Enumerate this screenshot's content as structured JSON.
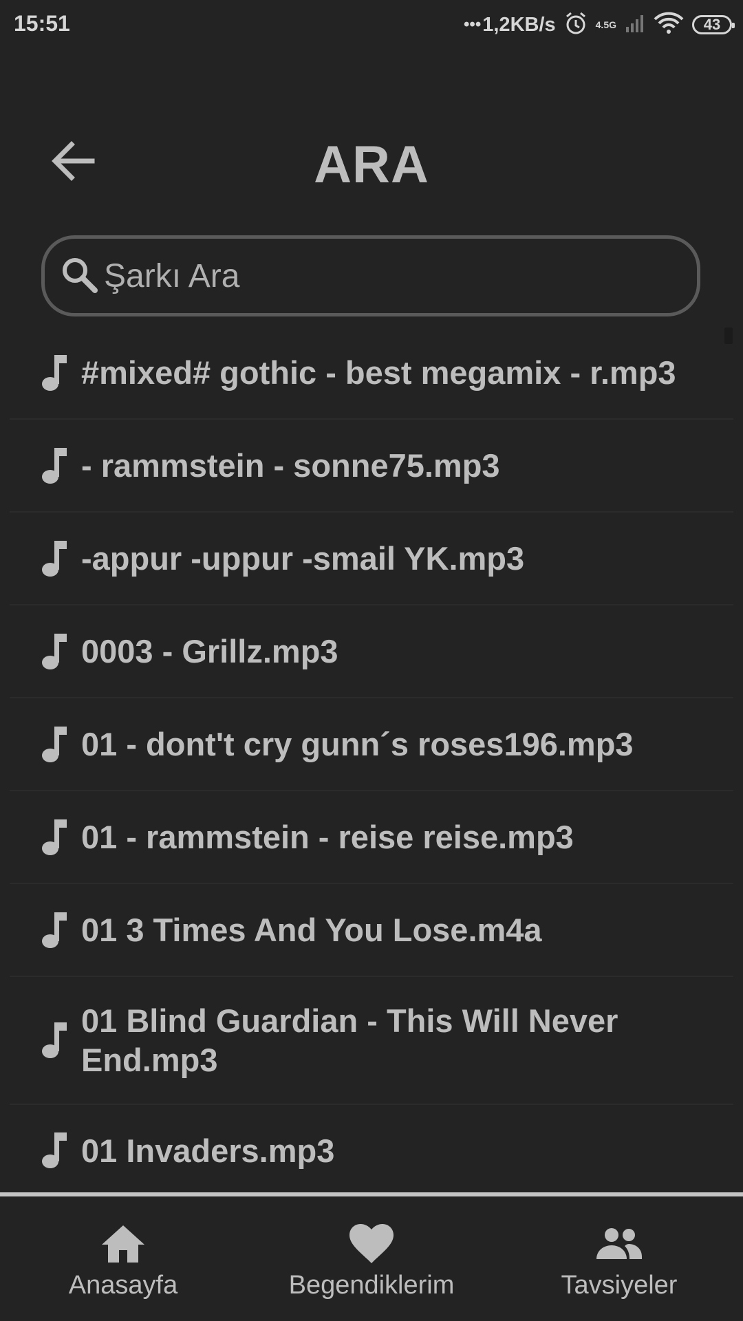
{
  "status_bar": {
    "time": "15:51",
    "dots": "•••",
    "speed": "1,2KB/s",
    "network": "4.5G",
    "battery": "43"
  },
  "header": {
    "title": "ARA"
  },
  "search": {
    "placeholder": "Şarkı Ara",
    "value": ""
  },
  "songs": [
    {
      "title": "#mixed# gothic - best megamix - r.mp3"
    },
    {
      "title": "- rammstein - sonne75.mp3"
    },
    {
      "title": "-appur -uppur -smail YK.mp3"
    },
    {
      "title": "0003 - Grillz.mp3"
    },
    {
      "title": "01 - dont't cry gunn´s roses196.mp3"
    },
    {
      "title": "01 - rammstein - reise reise.mp3"
    },
    {
      "title": "01 3 Times And You Lose.m4a"
    },
    {
      "title": "01 Blind Guardian - This Will Never End.mp3"
    },
    {
      "title": "01 Invaders.mp3"
    }
  ],
  "nav": {
    "home_label": "Anasayfa",
    "likes_label": "Begendiklerim",
    "recommend_label": "Tavsiyeler"
  },
  "colors": {
    "background": "#232323",
    "text": "#bdbdbd",
    "search_border": "#5a5a5a",
    "nav_border": "#c4c4c4"
  }
}
